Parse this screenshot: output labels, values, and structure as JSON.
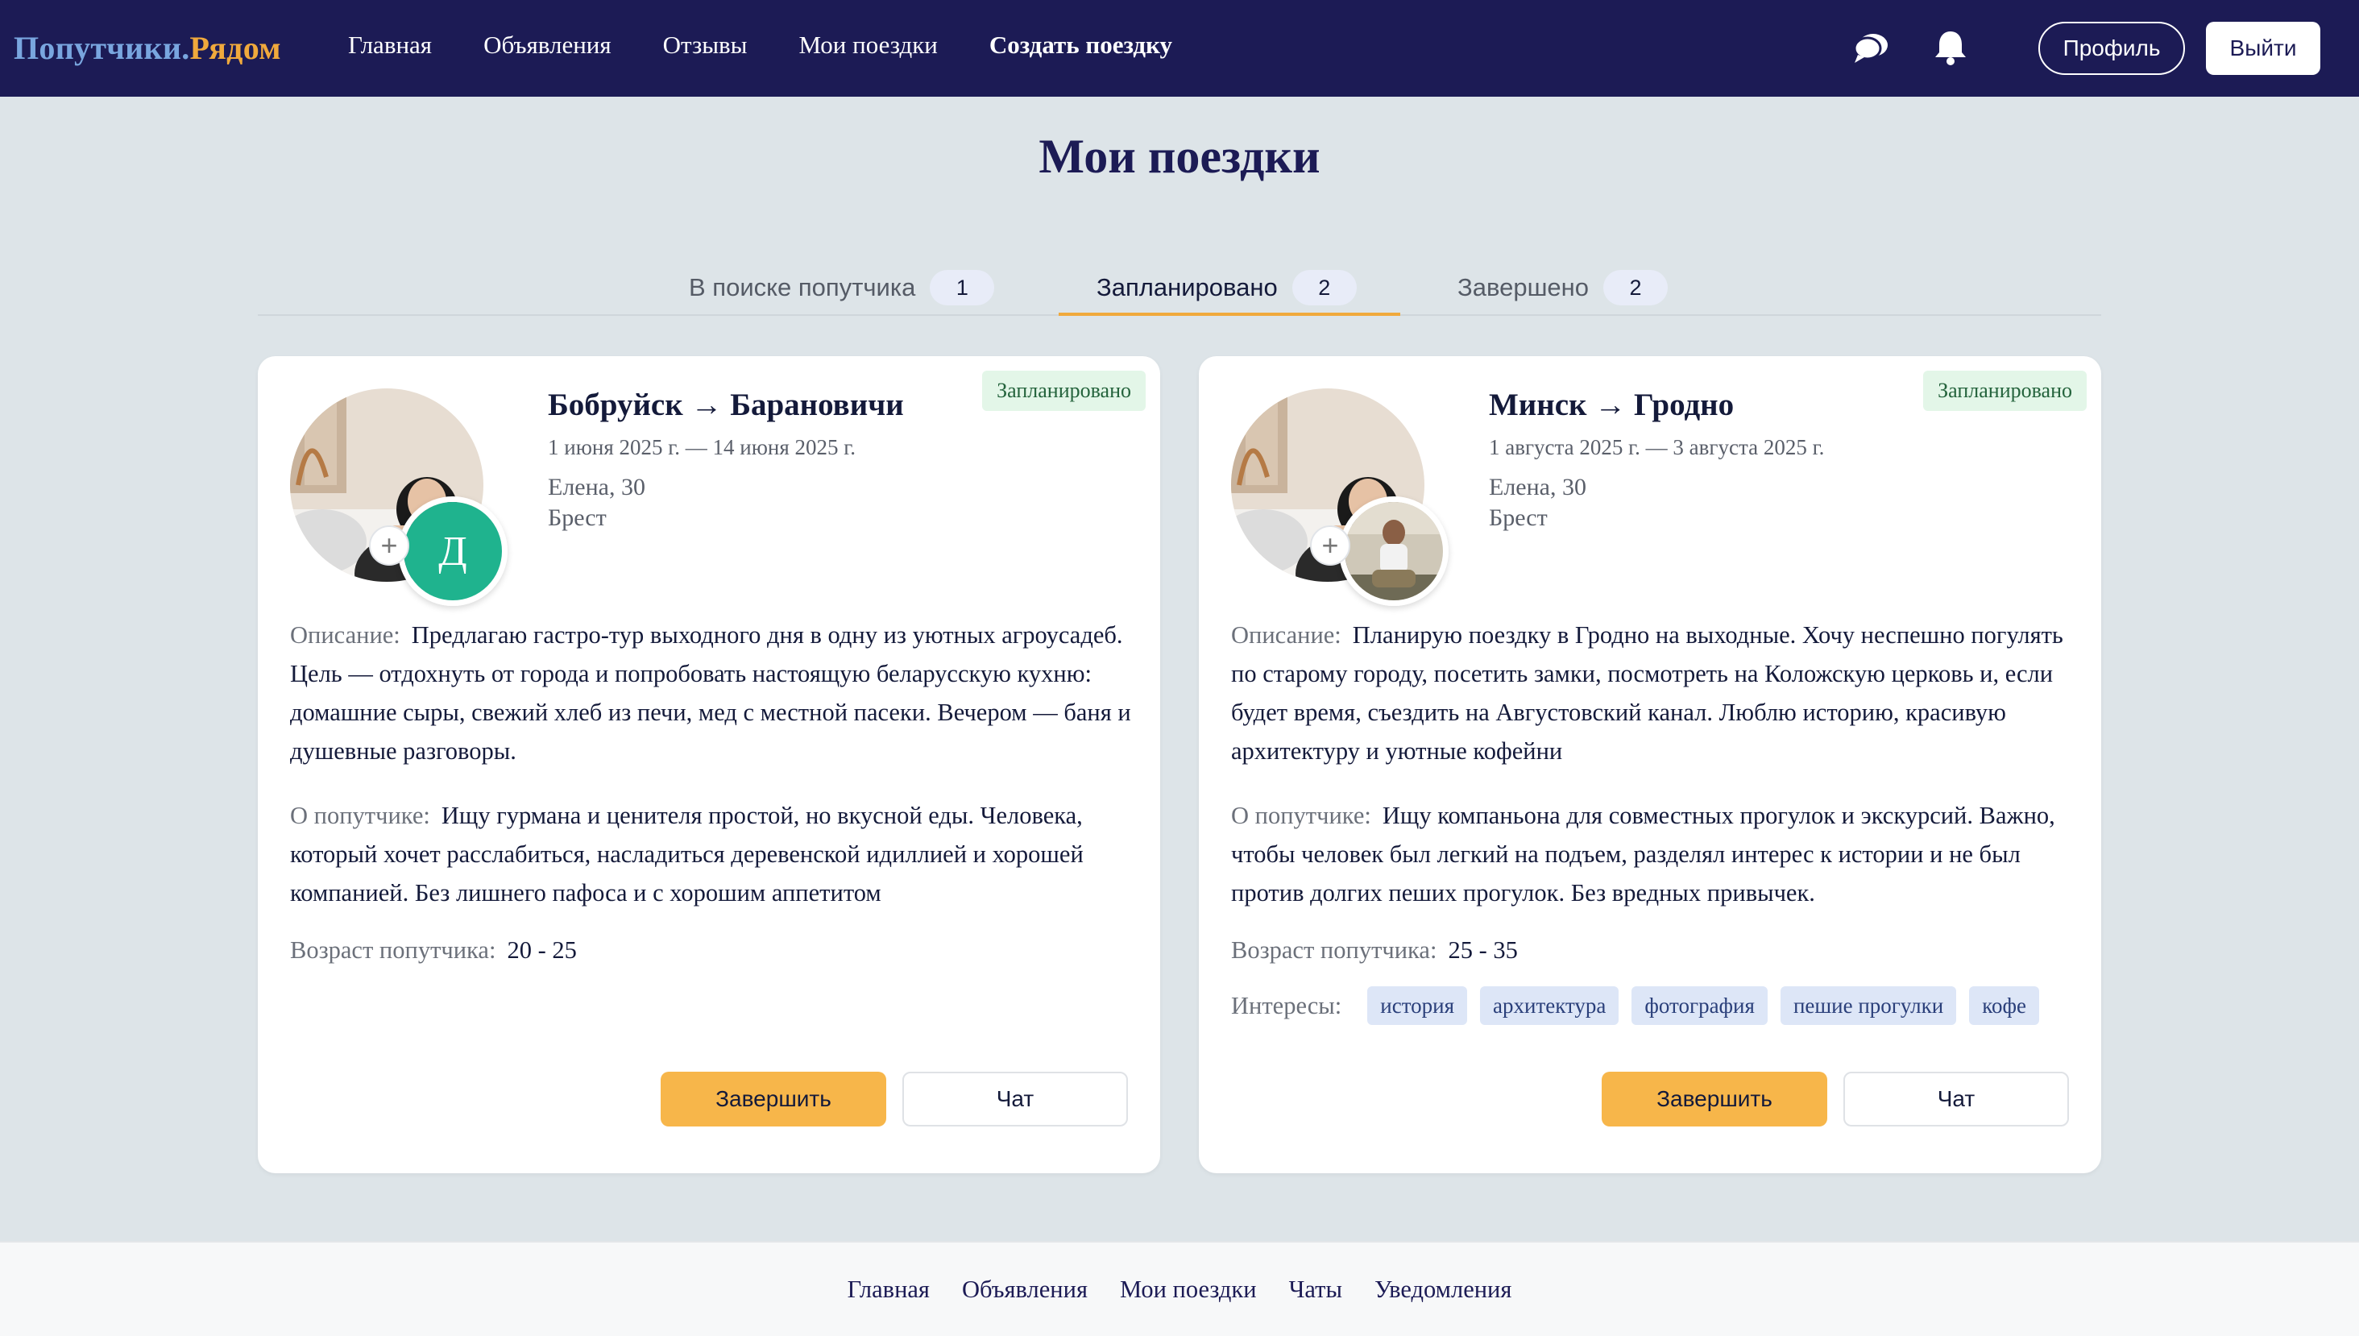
{
  "header": {
    "logo_part1": "Попутчики.",
    "logo_part2": "Рядом",
    "nav": [
      "Главная",
      "Объявления",
      "Отзывы",
      "Мои поездки",
      "Создать поездку"
    ],
    "icons": [
      "chat-bubbles-icon",
      "bell-icon"
    ],
    "profile_label": "Профиль",
    "logout_label": "Выйти"
  },
  "page_title": "Мои поездки",
  "tabs": [
    {
      "label": "В поиске попутчика",
      "count": "1"
    },
    {
      "label": "Запланировано",
      "count": "2",
      "active": true
    },
    {
      "label": "Завершено",
      "count": "2"
    }
  ],
  "cards": [
    {
      "status": "Запланировано",
      "route": "Бобруйск → Барановичи",
      "dates": "1 июня 2025 г. — 14 июня 2025 г.",
      "driver": "Елена, 30",
      "city": "Брест",
      "companion_avatar_letter": "Д",
      "description_label": "Описание:",
      "description": "Предлагаю гастро-тур выходного дня в одну из уютных агроусадеб. Цель — отдохнуть от города и попробовать настоящую беларусскую кухню: домашние сыры, свежий хлеб из печи, мед с местной пасеки. Вечером — баня и душевные разговоры.",
      "companion_label": "О попутчике:",
      "companion": "Ищу гурмана и ценителя простой, но вкусной еды. Человека, который хочет расслабиться, насладиться деревенской идиллией и хорошей компанией. Без лишнего пафоса и с хорошим аппетитом",
      "age_label": "Возраст попутчика:",
      "age": "20 - 25",
      "finish_label": "Завершить",
      "chat_label": "Чат"
    },
    {
      "status": "Запланировано",
      "route": "Минск → Гродно",
      "dates": "1 августа 2025 г. — 3 августа 2025 г.",
      "driver": "Елена, 30",
      "city": "Брест",
      "description_label": "Описание:",
      "description": "Планирую поездку в Гродно на выходные. Хочу неспешно погулять по старому городу, посетить замки, посмотреть на Коложскую церковь и, если будет время, съездить на Августовский канал. Люблю историю, красивую архитектуру и уютные кофейни",
      "companion_label": "О попутчике:",
      "companion": "Ищу компаньона для совместных прогулок и экскурсий. Важно, чтобы человек был легкий на подъем, разделял интерес к истории и не был против долгих пеших прогулок. Без вредных привычек.",
      "age_label": "Возраст попутчика:",
      "age": "25 - 35",
      "interests_label": "Интересы:",
      "interests": [
        "история",
        "архитектура",
        "фотография",
        "пешие прогулки",
        "кофе"
      ],
      "finish_label": "Завершить",
      "chat_label": "Чат"
    }
  ],
  "footer": [
    "Главная",
    "Объявления",
    "Мои поездки",
    "Чаты",
    "Уведомления"
  ],
  "colors": {
    "header_bg": "#1c1b55",
    "accent": "#f0a93c",
    "logo_blue": "#79a6df",
    "page_bg": "#dde4e8",
    "status_bg": "#e3f6e8",
    "tag_bg": "#dde6f7"
  }
}
